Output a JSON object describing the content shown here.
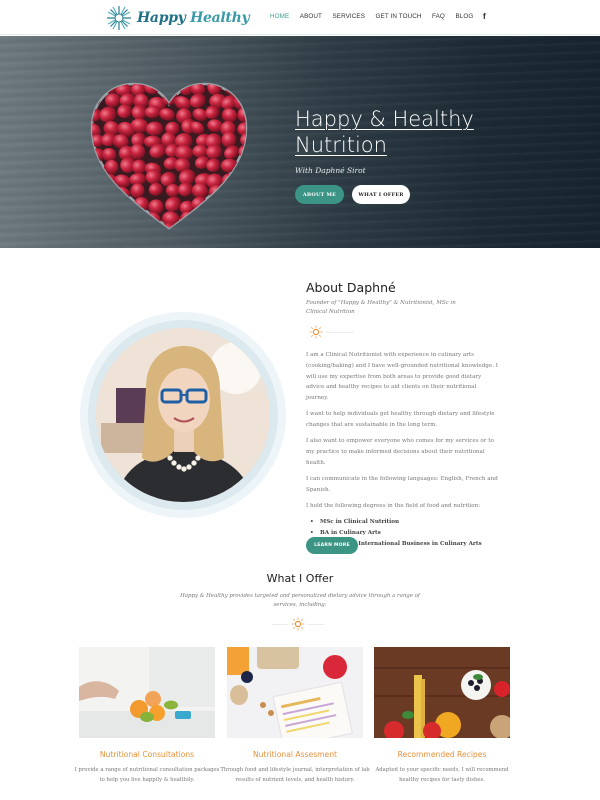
{
  "header": {
    "logo": {
      "word1": "Happy",
      "word2": "Healthy",
      "icon": "snowflake-mandala-logo-icon"
    },
    "nav": [
      {
        "label": "HOME",
        "active": true
      },
      {
        "label": "ABOUT",
        "active": false
      },
      {
        "label": "SERVICES",
        "active": false
      },
      {
        "label": "GET IN TOUCH",
        "active": false
      },
      {
        "label": "FAQ",
        "active": false
      },
      {
        "label": "BLOG",
        "active": false
      }
    ],
    "social": {
      "facebook_glyph": "f",
      "icon": "facebook-icon"
    }
  },
  "hero": {
    "title_line1": "Happy & Healthy",
    "title_line2": "Nutrition",
    "subtitle": "With Daphné Sirot",
    "buttons": {
      "about": "ABOUT ME",
      "offer": "WHAT I OFFER"
    },
    "image": "heart-shaped bowl of pomegranate seeds on grey wood"
  },
  "about": {
    "title": "About Daphné",
    "subtitle": "Founder of \"Happy & Healthy\" & Nutritionist, MSc in Clinical Nutrition",
    "paragraphs": [
      "I am a Clinical Nutritionist with experience in culinary arts (cooking/baking) and I have well-grounded nutritional knowledge. I will use my expertise from both areas to provide good dietary advice and healthy recipes to aid clients on their nutritional journey.",
      "I want to help individuals get healthy through dietary and lifestyle changes that are sustainable in the long term.",
      "I also want to empower everyone who comes for my services or to my practice to make informed decisions about their nutritional health.",
      "I can communicate in the following languages: English, French and Spanish.",
      "I hold the following degrees in the field of food and nutrition:"
    ],
    "degrees": [
      "MSc in Clinical Nutrition",
      "BA in Culinary Arts",
      "Bachelor of International Business in Culinary Arts"
    ],
    "learn_more": "LEARN MORE",
    "portrait": "portrait of Daphné with blue glasses and pearl necklace"
  },
  "offer": {
    "title": "What I Offer",
    "subtitle": "Happy & Healthy provides targeted and personalized dietary advice through a range of services, including:",
    "cards": [
      {
        "title": "Nutritional Consultations",
        "text": "I provide a range of nutritional consultation packages to help you live happily & healthily.",
        "image": "nutritionist with fruit on table"
      },
      {
        "title": "Nutritional Assesment",
        "text": "Through food and lifestyle journal, interpretation of lab results of nutrient levels, and health history.",
        "image": "weekly meal plan with apple and snacks"
      },
      {
        "title": "Recommended Recipes",
        "text": "Adapted to your specific needs, I will recommend healthy recipes for tasty dishes.",
        "image": "pasta, tomatoes, peppers and olives on wood"
      }
    ]
  },
  "colors": {
    "brand_teal": "#3b9484",
    "accent_orange": "#e8913a",
    "logo_blue": "#1f6f86"
  }
}
